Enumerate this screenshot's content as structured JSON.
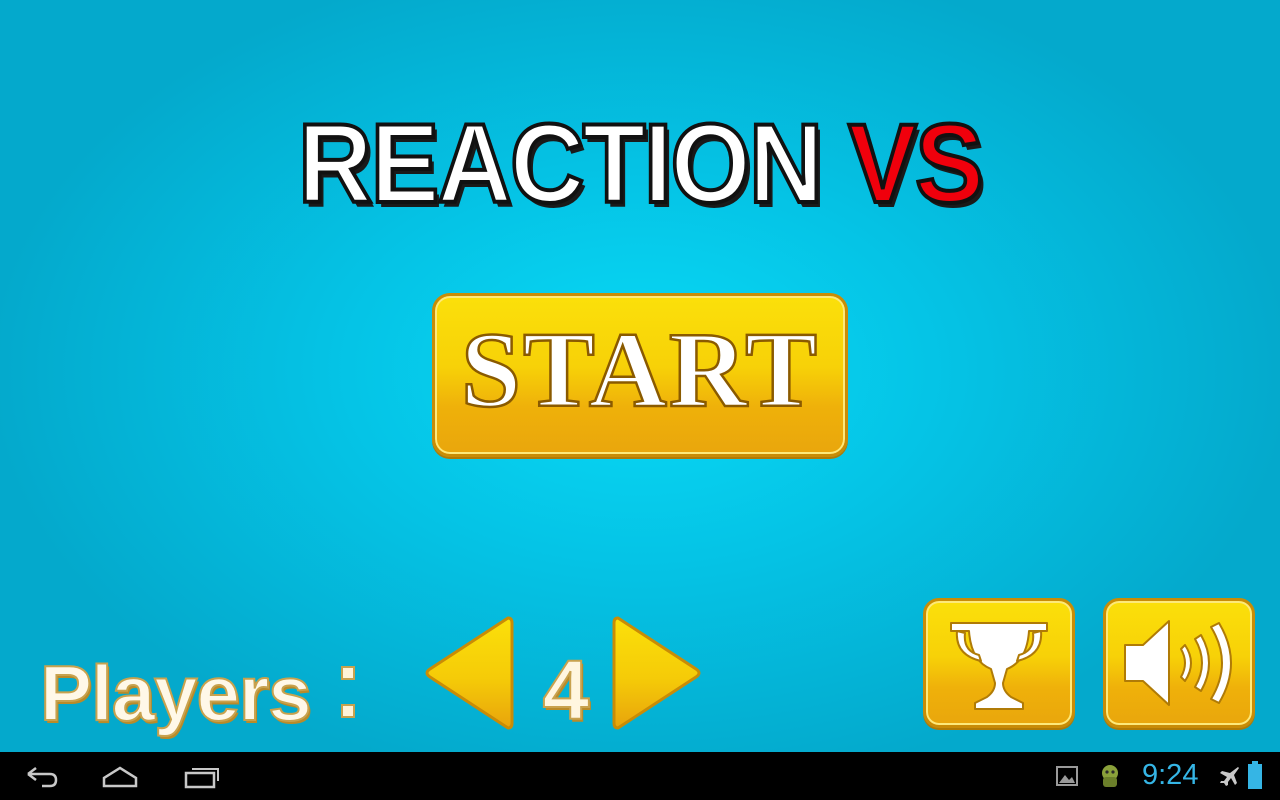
{
  "title": {
    "main": "REACTION",
    "accent": "VS"
  },
  "start_button": {
    "label": "START"
  },
  "players": {
    "label": "Players",
    "count": "4"
  },
  "buttons": {
    "leaderboard": "trophy-icon",
    "sound": "speaker-icon"
  },
  "status_bar": {
    "time": "9:24"
  },
  "colors": {
    "background": "#05c4e6",
    "gold": "#f7d108",
    "title_accent": "#f0000c",
    "clock": "#35b5e5"
  }
}
